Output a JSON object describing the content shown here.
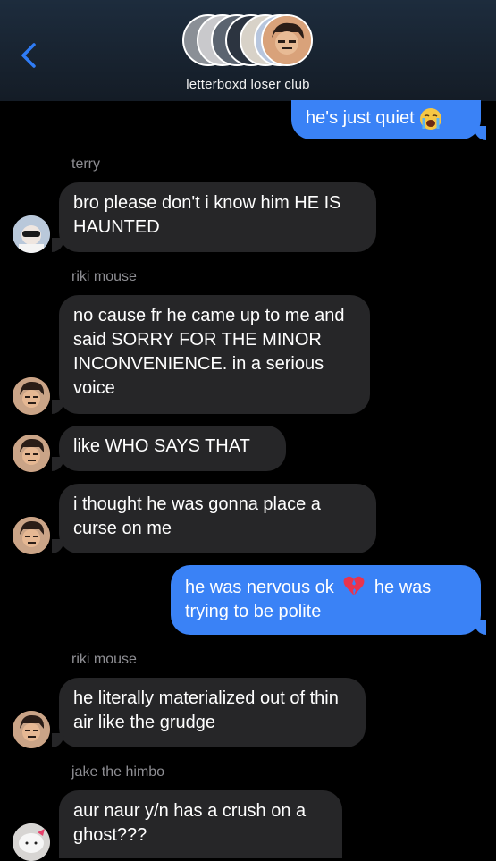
{
  "header": {
    "back_icon": "chevron-left-icon",
    "group_title": "letterboxd loser club"
  },
  "colors": {
    "outgoing": "#3a82f6",
    "incoming": "#262628",
    "sender_name": "#8e8e93",
    "accent": "#2f7cf6"
  },
  "messages": {
    "m0": {
      "text": "he's just quiet"
    },
    "s1": "terry",
    "m1": {
      "text": "bro please don't i know him HE IS HAUNTED"
    },
    "s2": "riki mouse",
    "m2": {
      "text": "no cause fr he came up to me and said SORRY FOR THE MINOR INCONVENIENCE. in a serious voice"
    },
    "m3": {
      "text": "like WHO SAYS THAT"
    },
    "m4": {
      "text": "i thought he was gonna place a curse on me"
    },
    "m5": {
      "text_a": "he was nervous ok",
      "text_b": "he was trying to be polite"
    },
    "s6": "riki mouse",
    "m6": {
      "text": "he literally materialized out of thin air like the grudge"
    },
    "s7": "jake the himbo",
    "m7": {
      "text": "aur naur y/n has a crush on a ghost???"
    }
  }
}
